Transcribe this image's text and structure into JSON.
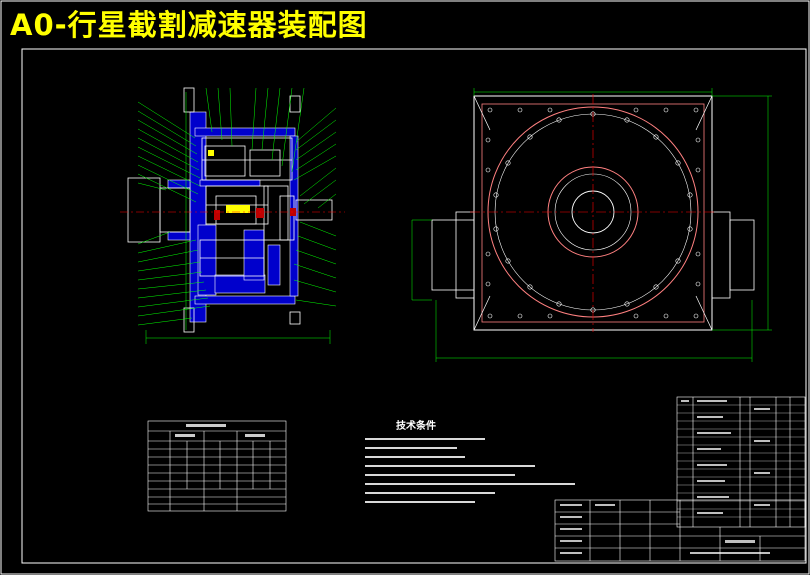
{
  "title": "A0-行星截割减速器装配图",
  "technical_requirements_title": "技术条件",
  "colors": {
    "background": "#000000",
    "title": "#ffff00",
    "frame": "#ffffff",
    "part": "#0000cc",
    "leader": "#00ff00",
    "centerline": "#ff0000",
    "outline": "#ff8080"
  }
}
